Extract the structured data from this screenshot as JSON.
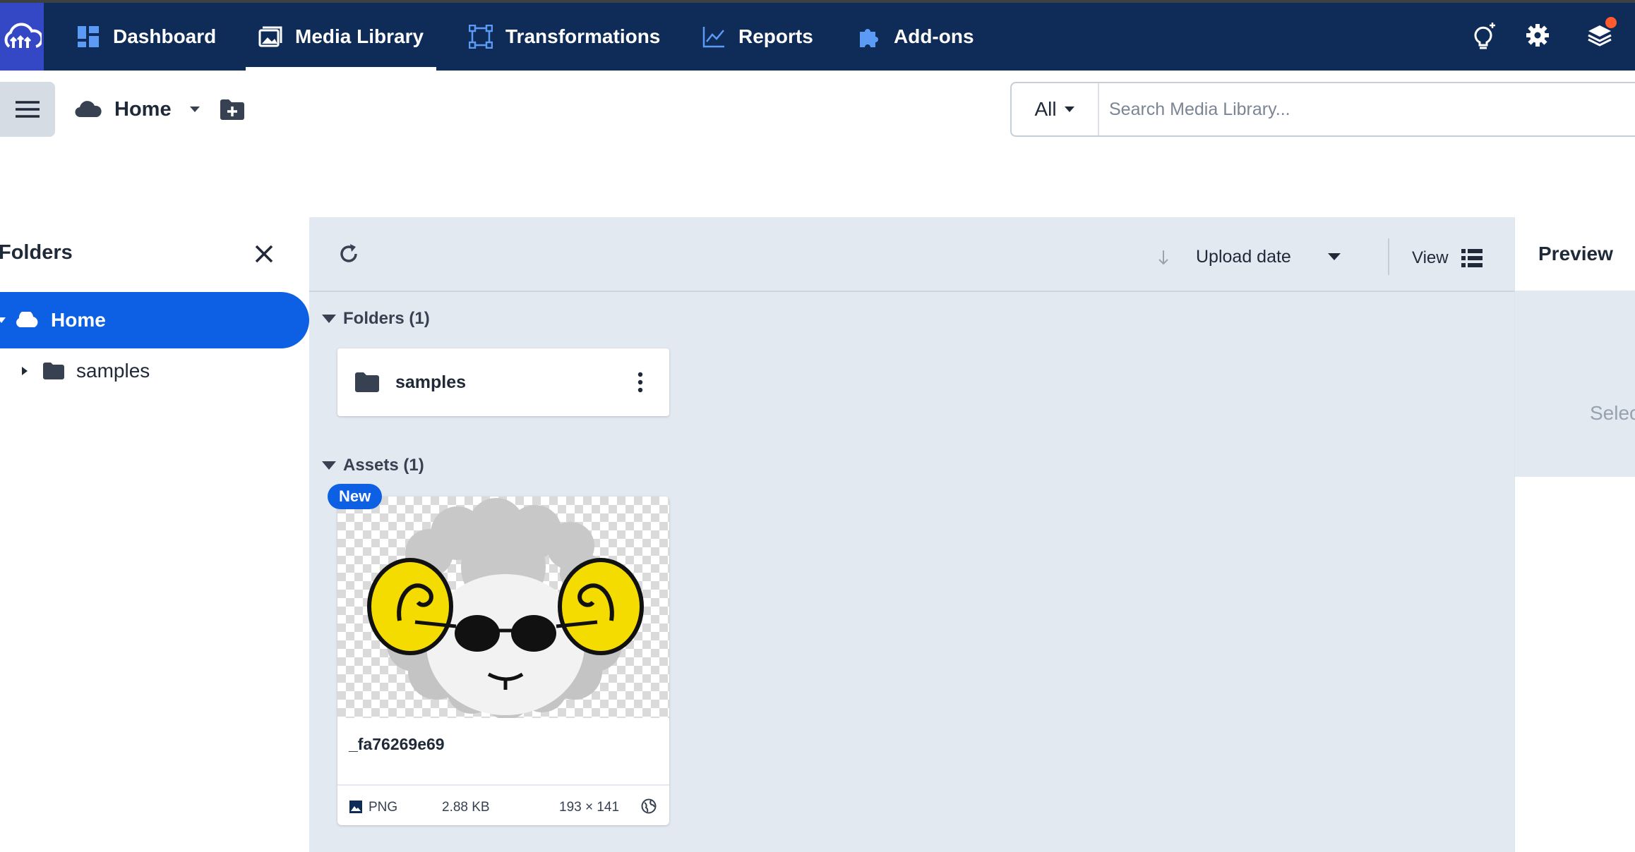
{
  "nav": {
    "items": [
      {
        "label": "Dashboard",
        "icon": "dashboard-icon"
      },
      {
        "label": "Media Library",
        "icon": "media-library-icon",
        "active": true
      },
      {
        "label": "Transformations",
        "icon": "transformations-icon"
      },
      {
        "label": "Reports",
        "icon": "reports-icon"
      },
      {
        "label": "Add-ons",
        "icon": "puzzle-icon"
      }
    ],
    "right_icons": [
      "lightbulb-icon",
      "gear-icon",
      "layers-icon"
    ],
    "has_notification": true
  },
  "toolbar": {
    "breadcrumb": "Home",
    "search": {
      "scope": "All",
      "placeholder": "Search Media Library..."
    }
  },
  "folders_panel": {
    "title": "Folders",
    "tree": {
      "root": "Home",
      "children": [
        "samples"
      ]
    }
  },
  "main": {
    "sort_label": "Upload date",
    "view_label": "View",
    "folders_section": "Folders (1)",
    "folders": [
      {
        "name": "samples"
      }
    ],
    "assets_section": "Assets (1)",
    "assets": [
      {
        "badge": "New",
        "name": "_fa76269e69",
        "format": "PNG",
        "size": "2.88 KB",
        "dimensions": "193 × 141"
      }
    ]
  },
  "preview": {
    "title": "Preview",
    "placeholder": "Selec"
  },
  "colors": {
    "nav_bg": "#0e2c57",
    "logo_bg": "#3448c5",
    "accent": "#0d5fe4",
    "notification": "#ff5b2e",
    "content_bg": "#e3e9f0"
  }
}
